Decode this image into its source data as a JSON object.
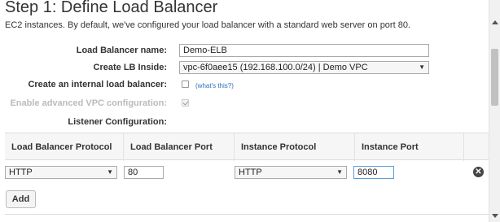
{
  "page": {
    "title": "Step 1: Define Load Balancer",
    "intro": "EC2 instances. By default, we've configured your load balancer with a standard web server on port 80."
  },
  "form": {
    "lb_name_label": "Load Balancer name:",
    "lb_name_value": "Demo-ELB",
    "create_inside_label": "Create LB Inside:",
    "create_inside_value": "vpc-6f0aee15 (192.168.100.0/24) | Demo VPC",
    "internal_label": "Create an internal load balancer:",
    "internal_checked": false,
    "whats_this": "(what's this?)",
    "advanced_vpc_label": "Enable advanced VPC configuration:",
    "advanced_vpc_checked": true,
    "listener_label": "Listener Configuration:"
  },
  "listener_table": {
    "headers": [
      "Load Balancer Protocol",
      "Load Balancer Port",
      "Instance Protocol",
      "Instance Port"
    ],
    "rows": [
      {
        "lb_protocol": "HTTP",
        "lb_port": "80",
        "instance_protocol": "HTTP",
        "instance_port": "8080"
      }
    ]
  },
  "actions": {
    "add_label": "Add"
  },
  "icons": {
    "select_arrow": "▼",
    "remove": "✕"
  }
}
